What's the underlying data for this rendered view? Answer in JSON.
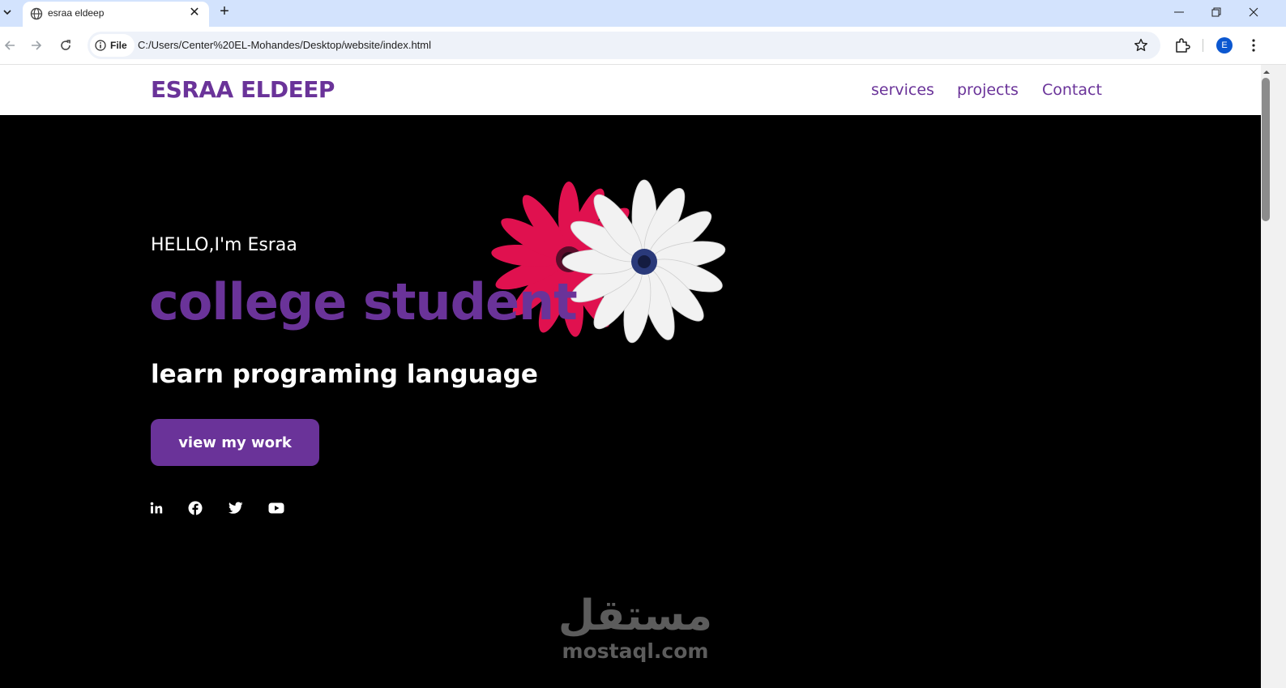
{
  "browser": {
    "tab": {
      "title": "esraa eldeep"
    },
    "new_tab_symbol": "+",
    "omnibox": {
      "chip_label": "File",
      "url": "C:/Users/Center%20EL-Mohandes/Desktop/website/index.html"
    },
    "profile_initial": "E",
    "window_controls": {
      "minimize": "—",
      "close": "✕"
    }
  },
  "site": {
    "logo": "ESRAA ELDEEP",
    "nav": [
      {
        "label": "services"
      },
      {
        "label": "projects"
      },
      {
        "label": "Contact"
      }
    ],
    "hero": {
      "greeting": "HELLO,I'm Esraa",
      "headline": "college student",
      "subheadline": "learn programing language",
      "cta_label": "view my work"
    },
    "social_icons": [
      "linkedin-icon",
      "facebook-icon",
      "twitter-icon",
      "youtube-icon"
    ],
    "colors": {
      "accent": "#6a3399",
      "background": "#000000",
      "text": "#ffffff"
    }
  },
  "watermark": {
    "arabic": "مستقل",
    "latin": "mostaql.com"
  }
}
